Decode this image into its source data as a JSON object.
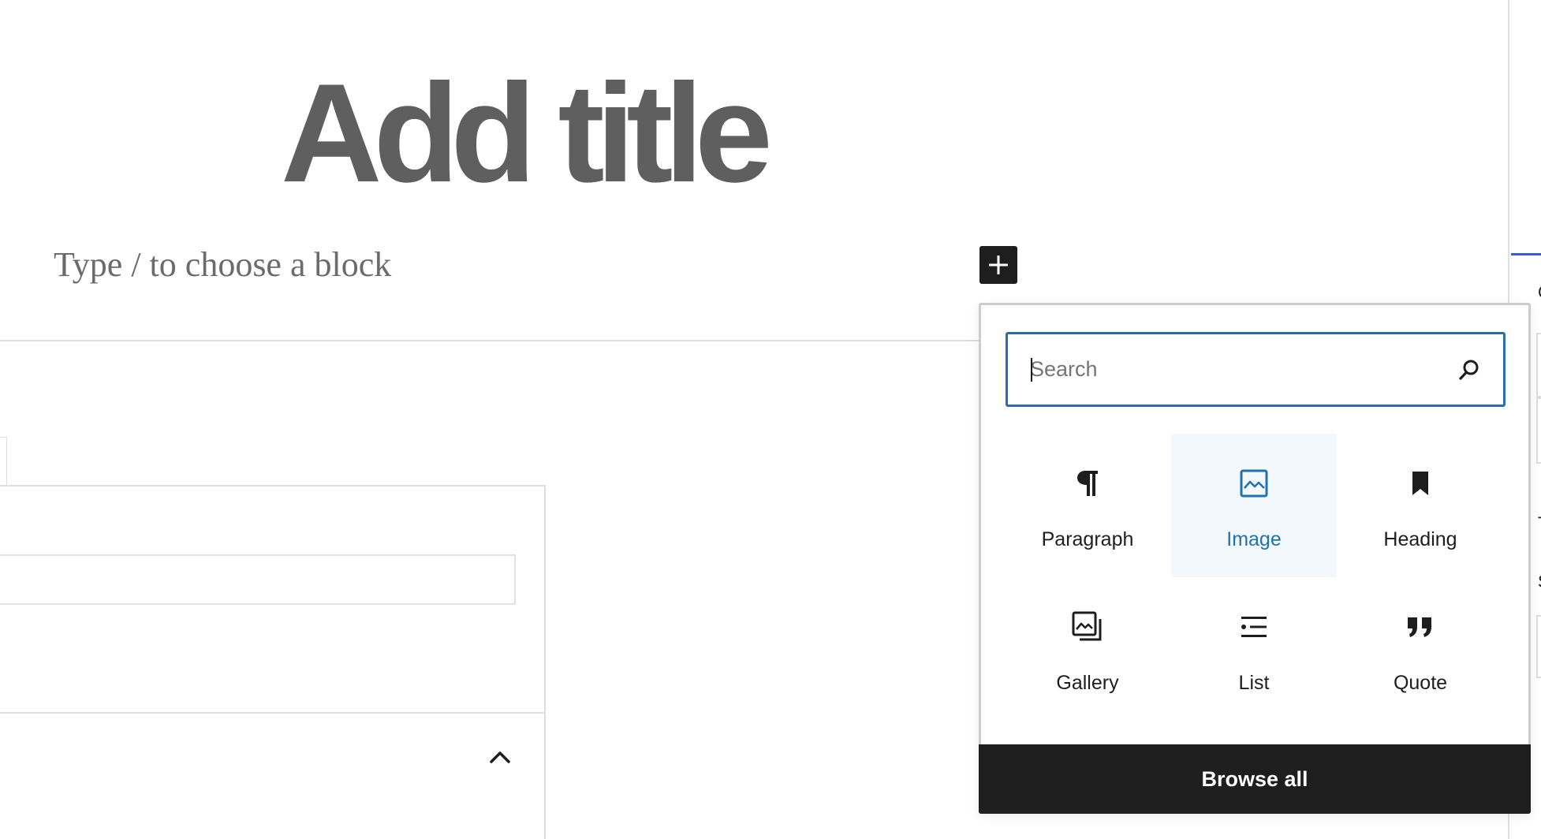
{
  "editor": {
    "title_placeholder": "Add title",
    "block_placeholder": "Type / to choose a block"
  },
  "inserter": {
    "toggle_icon": "plus-icon",
    "search": {
      "placeholder": "Search",
      "value": "",
      "icon": "search-icon"
    },
    "blocks": [
      {
        "label": "Paragraph",
        "icon": "paragraph-icon",
        "selected": false
      },
      {
        "label": "Image",
        "icon": "image-icon",
        "selected": true
      },
      {
        "label": "Heading",
        "icon": "heading-icon",
        "selected": false
      },
      {
        "label": "Gallery",
        "icon": "gallery-icon",
        "selected": false
      },
      {
        "label": "List",
        "icon": "list-icon",
        "selected": false
      },
      {
        "label": "Quote",
        "icon": "quote-icon",
        "selected": false
      }
    ],
    "browse_all_label": "Browse all"
  },
  "meta_panel": {
    "toggle_icon": "chevron-up-icon"
  },
  "sidebar": {
    "fragments": [
      "C",
      "T",
      "S"
    ]
  },
  "colors": {
    "accent": "#2271b1",
    "search_border": "#2c6db0",
    "selected_bg": "#f3f8fc",
    "dark": "#1e1e1e",
    "title_gray": "#5f5f5f"
  }
}
